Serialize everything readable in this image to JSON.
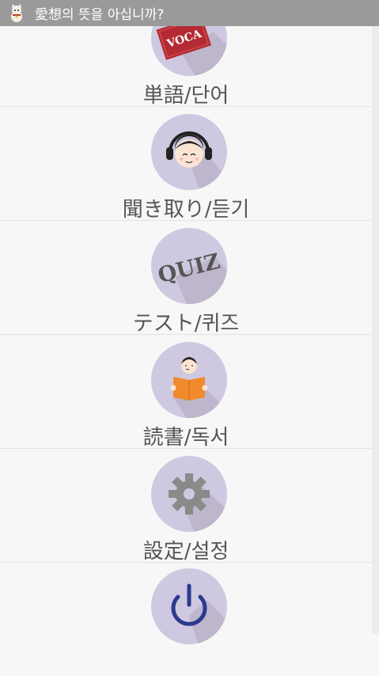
{
  "app": {
    "title": "愛想의 뜻을 아십니까?",
    "icon": "lucky-cat-icon"
  },
  "menu": {
    "items": [
      {
        "label": "単語/단어",
        "icon": "voca-card-icon",
        "icon_text": "VOCA"
      },
      {
        "label": "聞き取り/듣기",
        "icon": "headphones-listener-icon"
      },
      {
        "label": "テスト/퀴즈",
        "icon": "quiz-text-icon",
        "icon_text": "QUIZ"
      },
      {
        "label": "読書/독서",
        "icon": "reading-book-icon"
      },
      {
        "label": "設定/설정",
        "icon": "gear-icon"
      },
      {
        "label": "",
        "icon": "power-icon"
      }
    ]
  },
  "colors": {
    "topbar": "#9a9a9a",
    "circle": "#cfc8e1",
    "voca_card": "#b52b33",
    "book": "#f08a2c",
    "power": "#2b3a8f",
    "label": "#555555"
  }
}
